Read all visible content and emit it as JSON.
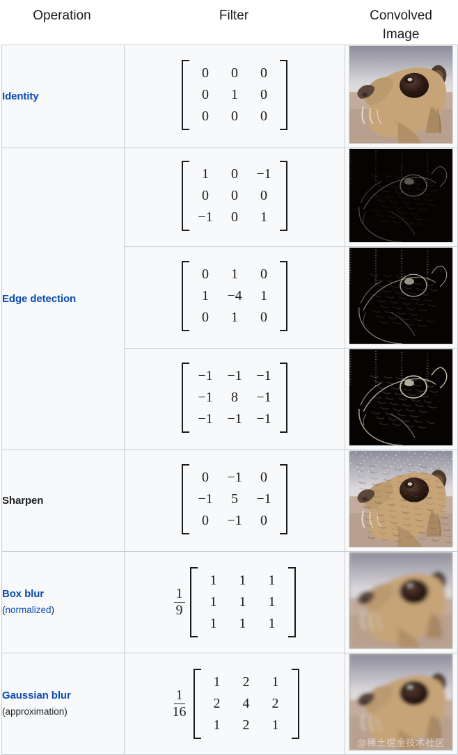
{
  "headers": {
    "operation": "Operation",
    "filter": "Filter",
    "convolved_line1": "Convolved",
    "convolved_line2": "Image"
  },
  "colors": {
    "link_blue": "#0b4bb3",
    "text": "#202122",
    "table_border": "#c8ccd1",
    "cell_bg": "#f8f9fa"
  },
  "watermark": "@稀土掘金技术社区",
  "rows": [
    {
      "operation": "Identity",
      "operation_is_link": true,
      "sub": "",
      "sub_is_link": false,
      "scalar_num": "",
      "scalar_den": "",
      "matrix": [
        [
          "0",
          "0",
          "0"
        ],
        [
          "0",
          "1",
          "0"
        ],
        [
          "0",
          "0",
          "0"
        ]
      ],
      "image_alt": "identity-convolved-wallaby",
      "image_style": "identity"
    },
    {
      "operation": "Edge detection",
      "operation_is_link": true,
      "sub": "",
      "sub_is_link": false,
      "scalar_num": "",
      "scalar_den": "",
      "matrix": [
        [
          "1",
          "0",
          "−1"
        ],
        [
          "0",
          "0",
          "0"
        ],
        [
          "−1",
          "0",
          "1"
        ]
      ],
      "image_alt": "edge-detection-convolved-wallaby-1",
      "image_style": "edge1"
    },
    {
      "operation": "",
      "operation_is_link": true,
      "sub": "",
      "sub_is_link": false,
      "scalar_num": "",
      "scalar_den": "",
      "matrix": [
        [
          "0",
          "1",
          "0"
        ],
        [
          "1",
          "−4",
          "1"
        ],
        [
          "0",
          "1",
          "0"
        ]
      ],
      "image_alt": "edge-detection-convolved-wallaby-2",
      "image_style": "edge2"
    },
    {
      "operation": "",
      "operation_is_link": true,
      "sub": "",
      "sub_is_link": false,
      "scalar_num": "",
      "scalar_den": "",
      "matrix": [
        [
          "−1",
          "−1",
          "−1"
        ],
        [
          "−1",
          "8",
          "−1"
        ],
        [
          "−1",
          "−1",
          "−1"
        ]
      ],
      "image_alt": "edge-detection-convolved-wallaby-3",
      "image_style": "edge3"
    },
    {
      "operation": "Sharpen",
      "operation_is_link": false,
      "sub": "",
      "sub_is_link": false,
      "scalar_num": "",
      "scalar_den": "",
      "matrix": [
        [
          "0",
          "−1",
          "0"
        ],
        [
          "−1",
          "5",
          "−1"
        ],
        [
          "0",
          "−1",
          "0"
        ]
      ],
      "image_alt": "sharpen-convolved-wallaby",
      "image_style": "sharpen"
    },
    {
      "operation": "Box blur",
      "operation_is_link": true,
      "sub": "(normalized)",
      "sub_is_link": true,
      "sub_word": "normalized",
      "scalar_num": "1",
      "scalar_den": "9",
      "matrix": [
        [
          "1",
          "1",
          "1"
        ],
        [
          "1",
          "1",
          "1"
        ],
        [
          "1",
          "1",
          "1"
        ]
      ],
      "image_alt": "box-blur-convolved-wallaby",
      "image_style": "boxblur"
    },
    {
      "operation": "Gaussian blur",
      "operation_is_link": true,
      "sub": "(approximation)",
      "sub_is_link": false,
      "sub_word": "approximation",
      "scalar_num": "1",
      "scalar_den": "16",
      "matrix": [
        [
          "1",
          "2",
          "1"
        ],
        [
          "2",
          "4",
          "2"
        ],
        [
          "1",
          "2",
          "1"
        ]
      ],
      "image_alt": "gaussian-blur-convolved-wallaby",
      "image_style": "gaussian"
    }
  ],
  "row_groups": {
    "edge_detection_label_row": 2,
    "edge_detection_rowspan": 3
  }
}
